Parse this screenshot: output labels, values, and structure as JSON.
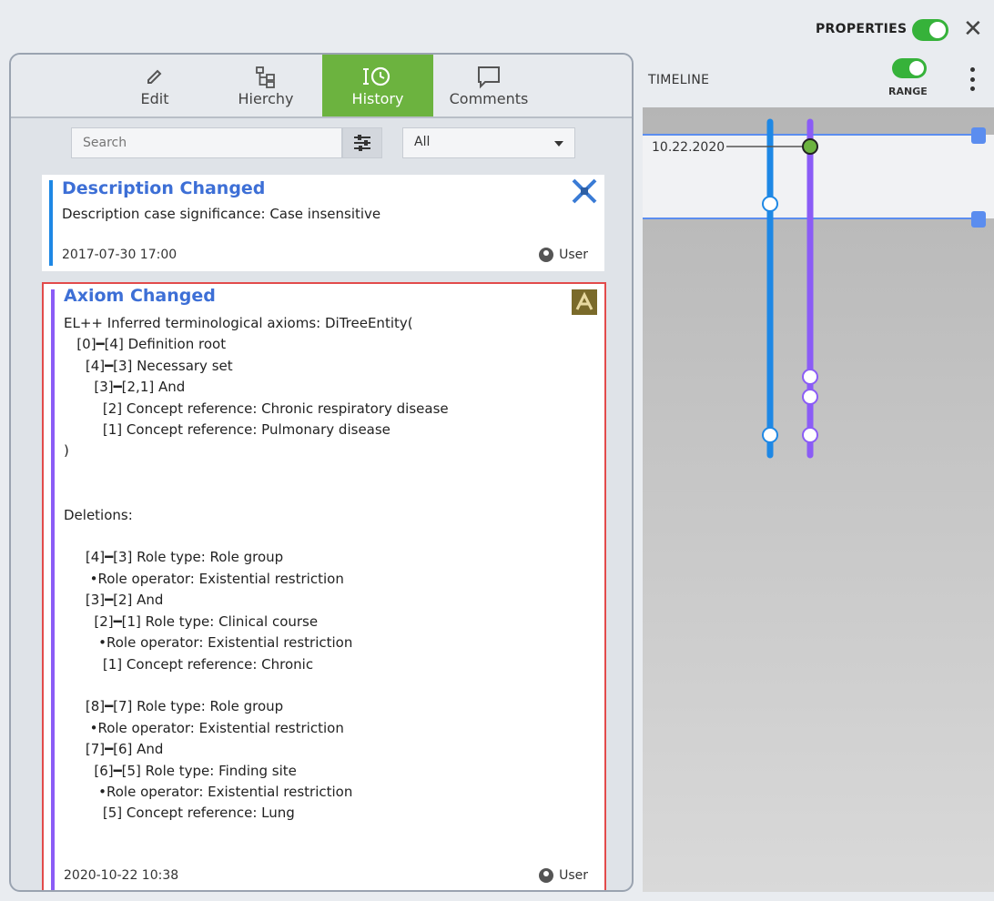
{
  "header": {
    "properties_label": "PROPERTIES",
    "close_symbol": "✕"
  },
  "tabs": [
    {
      "label": "Edit",
      "icon": "pencil-icon"
    },
    {
      "label": "Hierchy",
      "icon": "hierarchy-icon"
    },
    {
      "label": "History",
      "icon": "history-icon",
      "active": true
    },
    {
      "label": "Comments",
      "icon": "comment-icon"
    }
  ],
  "search": {
    "placeholder": "Search"
  },
  "filter": {
    "selected": "All"
  },
  "cards": [
    {
      "title": "Description Changed",
      "body": "Description case significance: Case insensitive",
      "date": "2017-07-30 17:00",
      "user": "User",
      "accent": "#1e88e5",
      "icon": "description-change-icon"
    },
    {
      "title": "Axiom Changed",
      "body": "EL++ Inferred terminological axioms: DiTreeEntity(\n   [0]━[4] Definition root\n     [4]━[3] Necessary set\n       [3]━[2,1] And\n         [2] Concept reference: Chronic respiratory disease\n         [1] Concept reference: Pulmonary disease\n)\n\n\nDeletions:\n\n     [4]━[3] Role type: Role group\n      •Role operator: Existential restriction\n     [3]━[2] And\n       [2]━[1] Role type: Clinical course\n        •Role operator: Existential restriction\n         [1] Concept reference: Chronic\n\n     [8]━[7] Role type: Role group\n      •Role operator: Existential restriction\n     [7]━[6] And\n       [6]━[5] Role type: Finding site\n        •Role operator: Existential restriction\n         [5] Concept reference: Lung",
      "date": "2020-10-22 10:38",
      "user": "User",
      "accent": "#8b5cf6",
      "border": "#e24b4b",
      "icon": "axiom-change-icon"
    }
  ],
  "timeline": {
    "title": "TIMELINE",
    "range_label": "RANGE",
    "date_label": "10.22.2020",
    "colors": {
      "track1": "#1e88e5",
      "track2": "#8b5cf6",
      "range_line": "#5b8def",
      "selected": "#6cb33f"
    }
  },
  "colors": {
    "accent_green": "#36b23a",
    "tab_active": "#6cb33f",
    "title_blue": "#3d6fd6"
  }
}
